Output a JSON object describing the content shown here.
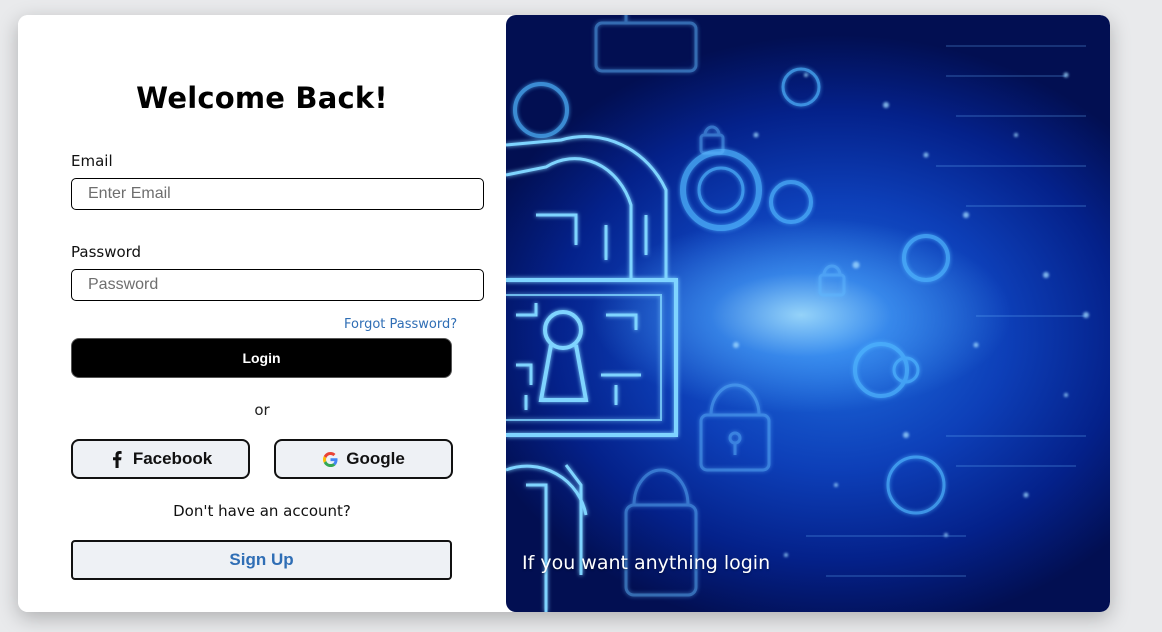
{
  "login": {
    "title": "Welcome Back!",
    "email_label": "Email",
    "email_placeholder": "Enter Email",
    "email_value": "",
    "password_label": "Password",
    "password_placeholder": "Password",
    "password_value": "",
    "forgot_password": "Forgot Password?",
    "login_button": "Login",
    "or_text": "or",
    "facebook_button": "Facebook",
    "google_button": "Google",
    "no_account_text": "Don't have an account?",
    "signup_button": "Sign Up"
  },
  "hero": {
    "caption": "If you want anything login"
  },
  "colors": {
    "accent_link": "#2f6eb5",
    "login_button_bg": "#000000",
    "secondary_button_bg": "#eef1f5",
    "hero_dark": "#04218a",
    "hero_glow": "#aee6ff"
  },
  "icons": {
    "facebook": "facebook-icon",
    "google": "google-icon",
    "hero_art": "circuit-padlock-illustration"
  }
}
